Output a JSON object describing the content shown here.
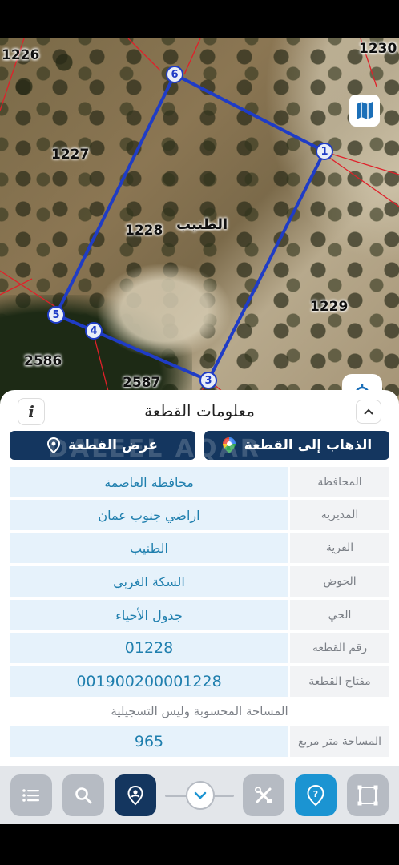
{
  "map": {
    "parcel_labels": {
      "p1226": "1226",
      "p1230": "1230",
      "p1227": "1227",
      "p1228": "1228",
      "p1229": "1229",
      "p2586": "2586",
      "p2587": "2587"
    },
    "village_label": "الطنيب",
    "vertices": [
      "1",
      "6",
      "5",
      "4",
      "3"
    ],
    "boundary_color": "#1f3cc6",
    "neighbor_line_color": "#e0202a"
  },
  "panel": {
    "title": "معلومات القطعة",
    "info_icon": "i",
    "go_to_parcel_label": "الذهاب إلى القطعة",
    "show_parcel_label": "عرض القطعة",
    "watermark": "DALEEL AQAR",
    "fields": [
      {
        "label": "المحافظة",
        "value": "محافظة العاصمة"
      },
      {
        "label": "المديرية",
        "value": "اراضي جنوب عمان"
      },
      {
        "label": "القرية",
        "value": "الطنيب"
      },
      {
        "label": "الحوض",
        "value": "السكة الغربي"
      },
      {
        "label": "الحي",
        "value": "جدول الأحياء"
      },
      {
        "label": "رقم القطعة",
        "value": "01228"
      },
      {
        "label": "مفتاح القطعة",
        "value": "001900200001228"
      }
    ],
    "area_note": "المساحة المحسوبة وليس التسجيلية",
    "area": {
      "label": "المساحة متر مربع",
      "value": "965"
    }
  },
  "toolbar": {
    "items": [
      "list-icon",
      "search-icon",
      "location-pin-icon",
      "chevron-down-icon",
      "tools-icon",
      "help-icon",
      "polygon-icon"
    ]
  },
  "colors": {
    "navy": "#14365f",
    "accent_blue": "#1b94d2",
    "value_bg": "#e6f2fb",
    "value_text": "#1f7fae"
  }
}
